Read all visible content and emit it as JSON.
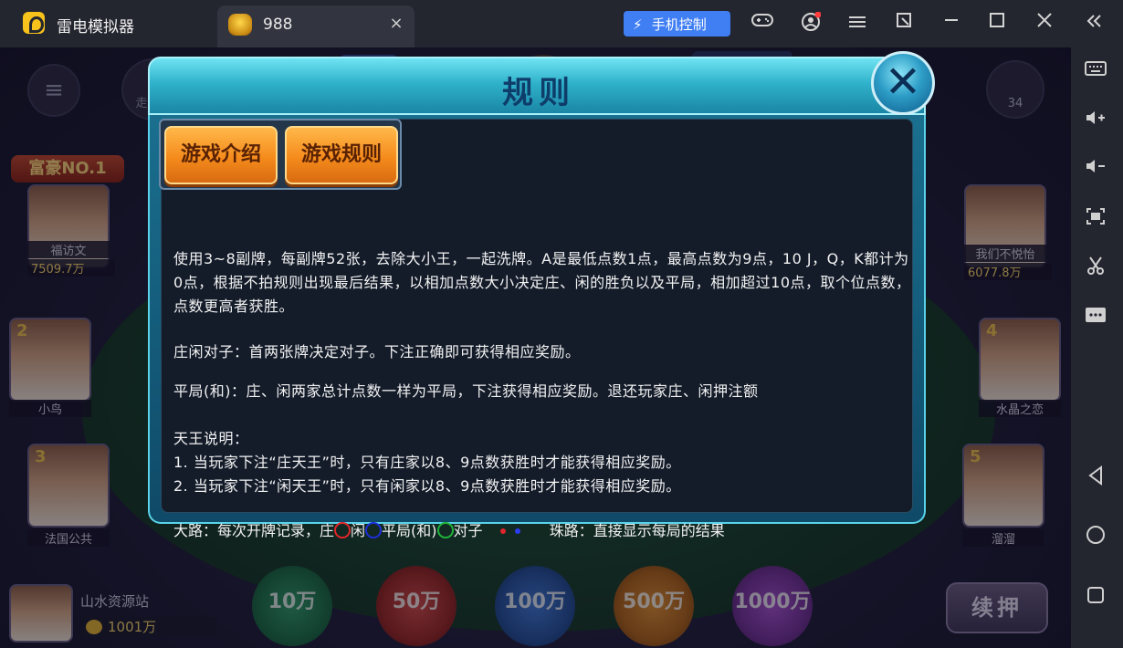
{
  "window": {
    "app_title": "雷电模拟器",
    "tab_label": "988",
    "tab_close": "×",
    "phone_control_label": "手机控制",
    "icons": [
      "gamepad-icon",
      "account-icon",
      "menu-icon",
      "popout-icon",
      "minimize-icon",
      "maximize-icon",
      "close-icon",
      "collapse-icon"
    ]
  },
  "sidepanel": {
    "icons": [
      "keyboard-icon",
      "volume-up-icon",
      "volume-down-icon",
      "screenshot-icon",
      "scissors-icon",
      "more-icon",
      "back-icon",
      "home-icon",
      "recents-icon"
    ]
  },
  "game": {
    "trend_label": "走势图",
    "online_count": "34",
    "rank_badge": "富豪NO.1",
    "players": [
      {
        "name": "福访文",
        "coins": "7509.7万",
        "seat": ""
      },
      {
        "name": "小鸟",
        "coins": "",
        "seat": "2"
      },
      {
        "name": "法国公共",
        "coins": "",
        "seat": "3"
      },
      {
        "name": "我们不悦怡",
        "coins": "6077.8万",
        "seat": ""
      },
      {
        "name": "水晶之恋",
        "coins": "",
        "seat": "4"
      },
      {
        "name": "溜溜",
        "coins": "",
        "seat": "5"
      }
    ],
    "self": {
      "name": "山水资源站",
      "coins": "1001万"
    },
    "chips": [
      "10万",
      "50万",
      "100万",
      "500万",
      "1000万"
    ],
    "rebet_label": "续押"
  },
  "dialog": {
    "title": "规则",
    "close_label": "✕",
    "tabs": [
      "游戏介绍",
      "游戏规则"
    ],
    "paragraphs": [
      "使用3~8副牌，每副牌52张，去除大小王，一起洗牌。A是最低点数1点，最高点数为9点，10 J，Q，K都计为0点，根据不拍规则出现最后结果，以相加点数大小决定庄、闲的胜负以及平局，相加超过10点，取个位点数，点数更高者获胜。",
      "庄闲对子：首两张牌决定对子。下注正确即可获得相应奖励。",
      "平局(和)：庄、闲两家总计点数一样为平局，下注获得相应奖励。退还玩家庄、闲押注额",
      "天王说明：",
      "1. 当玩家下注“庄天王”时，只有庄家以8、9点数获胜时才能获得相应奖励。",
      "2. 当玩家下注“闲天王”时，只有闲家以8、9点数获胜时才能获得相应奖励。"
    ],
    "legend": {
      "prefix": "大路：每次开牌记录，庄",
      "player": "闲",
      "tie": "平局(和)",
      "pair": "对子",
      "bead_road": "珠路：直接显示每局的结果"
    }
  },
  "colors": {
    "banker_ring": "#e0262b",
    "player_ring": "#1d2fd6",
    "tie_ring": "#1fb23a",
    "red_dot": "#e0262b",
    "blue_dot": "#2a3df0",
    "phone_control_bg": "#3f7ef3"
  }
}
